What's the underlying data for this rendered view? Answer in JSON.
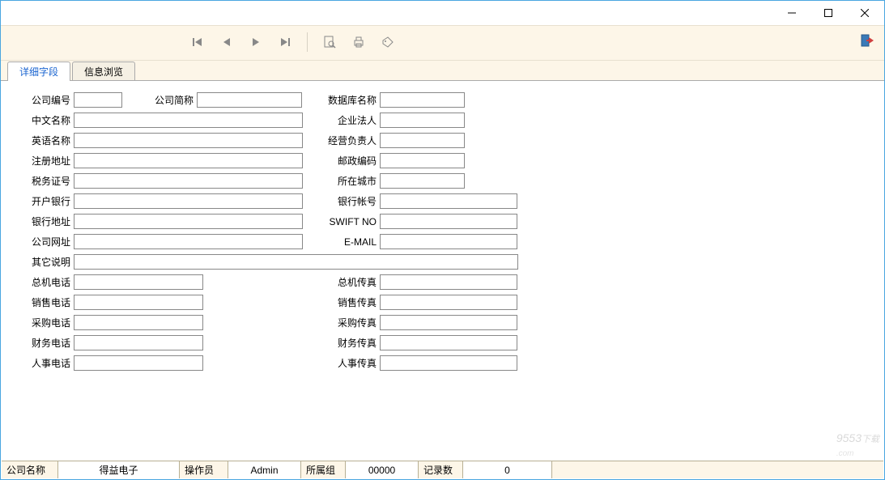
{
  "window": {
    "title": ""
  },
  "tabs": {
    "detail": "详细字段",
    "browse": "信息浏览"
  },
  "labels": {
    "companyId": "公司编号",
    "companyAbbr": "公司简称",
    "dbName": "数据库名称",
    "chineseName": "中文名称",
    "legalPerson": "企业法人",
    "englishName": "英语名称",
    "manager": "经营负责人",
    "regAddress": "注册地址",
    "postcode": "邮政编码",
    "taxNo": "税务证号",
    "city": "所在城市",
    "bank": "开户银行",
    "bankAcct": "银行帐号",
    "bankAddr": "银行地址",
    "swift": "SWIFT NO",
    "website": "公司网址",
    "email": "E-MAIL",
    "otherNote": "其它说明",
    "mainPhone": "总机电话",
    "mainFax": "总机传真",
    "salesPhone": "销售电话",
    "salesFax": "销售传真",
    "purchPhone": "采购电话",
    "purchFax": "采购传真",
    "finPhone": "财务电话",
    "finFax": "财务传真",
    "hrPhone": "人事电话",
    "hrFax": "人事传真"
  },
  "values": {
    "companyId": "",
    "companyAbbr": "",
    "dbName": "",
    "chineseName": "",
    "legalPerson": "",
    "englishName": "",
    "manager": "",
    "regAddress": "",
    "postcode": "",
    "taxNo": "",
    "city": "",
    "bank": "",
    "bankAcct": "",
    "bankAddr": "",
    "swift": "",
    "website": "",
    "email": "",
    "otherNote": "",
    "mainPhone": "",
    "mainFax": "",
    "salesPhone": "",
    "salesFax": "",
    "purchPhone": "",
    "purchFax": "",
    "finPhone": "",
    "finFax": "",
    "hrPhone": "",
    "hrFax": ""
  },
  "status": {
    "companyNameLbl": "公司名称",
    "companyName": "得益电子",
    "operatorLbl": "操作员",
    "operator": "Admin",
    "groupLbl": "所属组",
    "group": "00000",
    "recordsLbl": "记录数",
    "records": "0"
  },
  "watermark": "9553下载\n.com"
}
